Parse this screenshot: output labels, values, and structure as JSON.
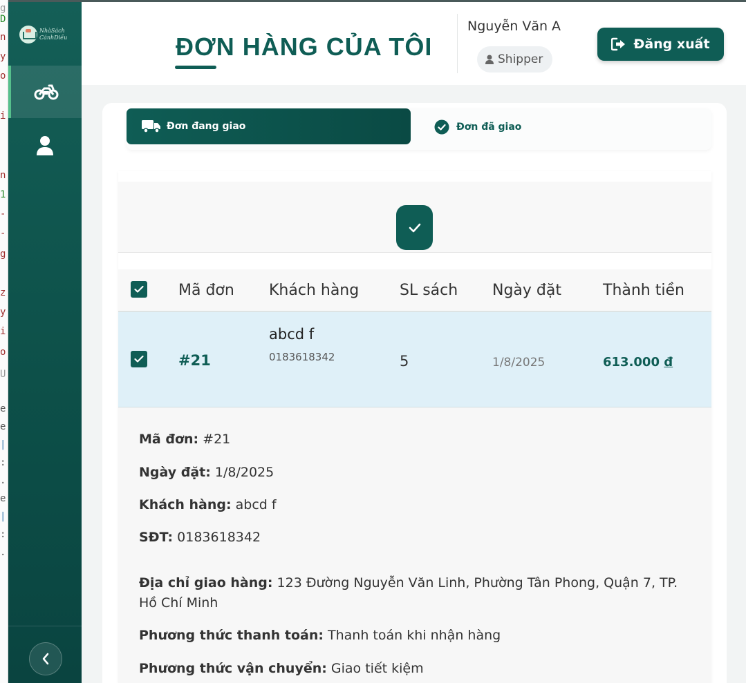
{
  "app": {
    "logo_text_1": "NhàSách",
    "logo_text_2": "CánhDiều"
  },
  "sidebar": {
    "items": [
      {
        "icon": "motorcycle-icon",
        "active": true
      },
      {
        "icon": "user-icon",
        "active": false
      }
    ],
    "collapse_icon": "chevron-left-icon"
  },
  "header": {
    "title": "ĐƠN HÀNG CỦA TÔI",
    "user_name": "Nguyễn Văn A",
    "role": "Shipper",
    "logout_label": "Đăng xuất"
  },
  "tabs": [
    {
      "label": "Đơn đang giao",
      "icon": "truck-icon",
      "active": true
    },
    {
      "label": "Đơn đã giao",
      "icon": "check-circle-icon",
      "active": false
    }
  ],
  "table": {
    "columns": [
      "Mã đơn",
      "Khách hàng",
      "SL sách",
      "Ngày đặt",
      "Thành tiền"
    ],
    "header_checked": true,
    "rows": [
      {
        "checked": true,
        "order_id": "#21",
        "customer_name": "abcd f",
        "customer_phone": "0183618342",
        "quantity": "5",
        "order_date": "1/8/2025",
        "total_amount": "613.000",
        "currency": "đ"
      }
    ]
  },
  "details": {
    "order_id_label": "Mã đơn:",
    "order_id": "#21",
    "order_date_label": "Ngày đặt:",
    "order_date": "1/8/2025",
    "customer_label": "Khách hàng:",
    "customer": "abcd f",
    "phone_label": "SĐT:",
    "phone": "0183618342",
    "address_label": "Địa chỉ giao hàng:",
    "address": "123 Đường Nguyễn Văn Linh, Phường Tân Phong, Quận 7, TP. Hồ Chí Minh",
    "payment_label": "Phương thức thanh toán:",
    "payment": "Thanh toán khi nhận hàng",
    "shipping_label": "Phương thức vận chuyển:",
    "shipping": "Giao tiết kiệm"
  },
  "colors": {
    "primary": "#0f5d55",
    "sidebar": "#0d5049",
    "row_highlight": "#dff0f8",
    "accent_active": "#56c08c"
  }
}
